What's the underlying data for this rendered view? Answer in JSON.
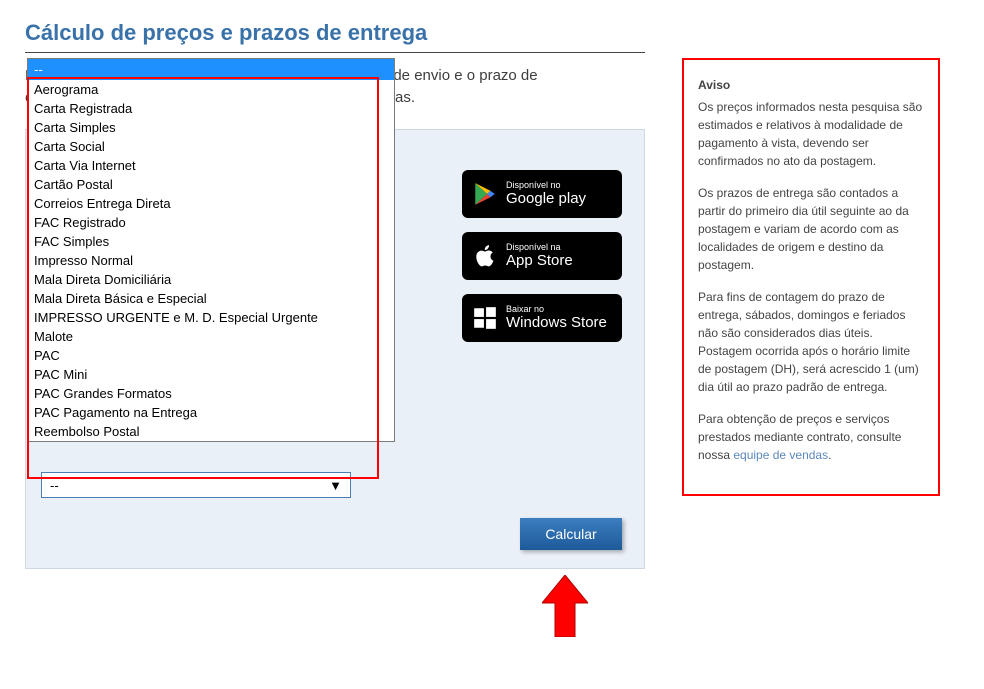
{
  "title": "Cálculo de preços e prazos de entrega",
  "intro_line1_prefix": "Pr",
  "intro_line1_suffix": " de envio e o prazo de",
  "intro_line2_prefix": "en",
  "intro_line2_suffix": "as.",
  "dropdown": {
    "selected": "--",
    "options": [
      "Aerograma",
      "Carta Registrada",
      "Carta Simples",
      "Carta Social",
      "Carta Via Internet",
      "Cartão Postal",
      "Correios Entrega Direta",
      "FAC Registrado",
      "FAC Simples",
      "Impresso Normal",
      "Mala Direta Domiciliária",
      "Mala Direta Básica e Especial",
      "IMPRESSO URGENTE e M. D. Especial Urgente",
      "Malote",
      "PAC",
      "PAC Mini",
      "PAC Grandes Formatos",
      "PAC Pagamento na Entrega",
      "Reembolso Postal"
    ]
  },
  "second_select": "--",
  "calc_button": "Calcular",
  "badges": {
    "google": {
      "small": "Disponível no",
      "big": "Google play"
    },
    "apple": {
      "small": "Disponível na",
      "big": "App Store"
    },
    "windows": {
      "small": "Baixar no",
      "big": "Windows Store"
    }
  },
  "aviso": {
    "title": "Aviso",
    "p1": "Os preços informados nesta pesquisa são estimados e relativos à modalidade de pagamento à vista, devendo ser confirmados no ato da postagem.",
    "p2": "Os prazos de entrega são contados a partir do primeiro dia útil seguinte ao da postagem e variam de acordo com as localidades de origem e destino da postagem.",
    "p3": "Para fins de contagem do prazo de entrega, sábados, domingos e feriados não são considerados dias úteis. Postagem ocorrida após o horário limite de postagem (DH), será acrescido 1 (um) dia útil ao prazo padrão de entrega.",
    "p4_prefix": "Para obtenção de preços e serviços prestados mediante contrato, consulte nossa ",
    "p4_link": "equipe de vendas",
    "p4_suffix": "."
  }
}
